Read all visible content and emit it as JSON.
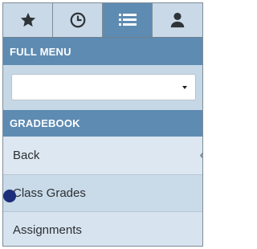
{
  "tabs": [
    {
      "icon": "star-icon",
      "active": false
    },
    {
      "icon": "clock-icon",
      "active": false
    },
    {
      "icon": "list-icon",
      "active": true
    },
    {
      "icon": "user-icon",
      "active": false
    }
  ],
  "full_menu": {
    "header": "FULL MENU",
    "select": {
      "value": ""
    }
  },
  "gradebook": {
    "header": "GRADEBOOK",
    "items": [
      {
        "label": "Back",
        "chevron": "‹"
      },
      {
        "label": "Class Grades"
      },
      {
        "label": "Assignments"
      }
    ]
  },
  "colors": {
    "accent": "#5e8bb2",
    "panel": "#d7e3ee",
    "marker": "#1d2e7a"
  }
}
